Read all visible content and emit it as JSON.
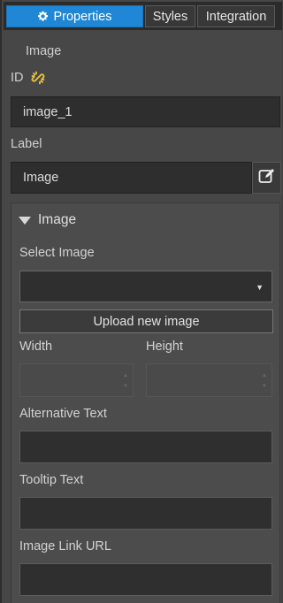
{
  "tabs": {
    "properties": "Properties",
    "styles": "Styles",
    "integration": "Integration"
  },
  "section_title": "Image",
  "id_field": {
    "label": "ID",
    "value": "image_1"
  },
  "label_field": {
    "label": "Label",
    "value": "Image"
  },
  "image_group": {
    "title": "Image",
    "select_image_label": "Select Image",
    "select_image_value": "",
    "upload_button": "Upload new image",
    "width_label": "Width",
    "height_label": "Height",
    "alt_text_label": "Alternative Text",
    "tooltip_label": "Tooltip Text",
    "link_url_label": "Image Link URL"
  },
  "icons": {
    "tab_properties": "gear-icon",
    "id_link": "link-icon",
    "edit": "edit-icon",
    "collapse": "triangle-down-icon",
    "select": "caret-down-icon"
  },
  "colors": {
    "active_tab": "#1f87d6",
    "panel_bg": "#474747",
    "input_bg": "#2e2e2e"
  }
}
